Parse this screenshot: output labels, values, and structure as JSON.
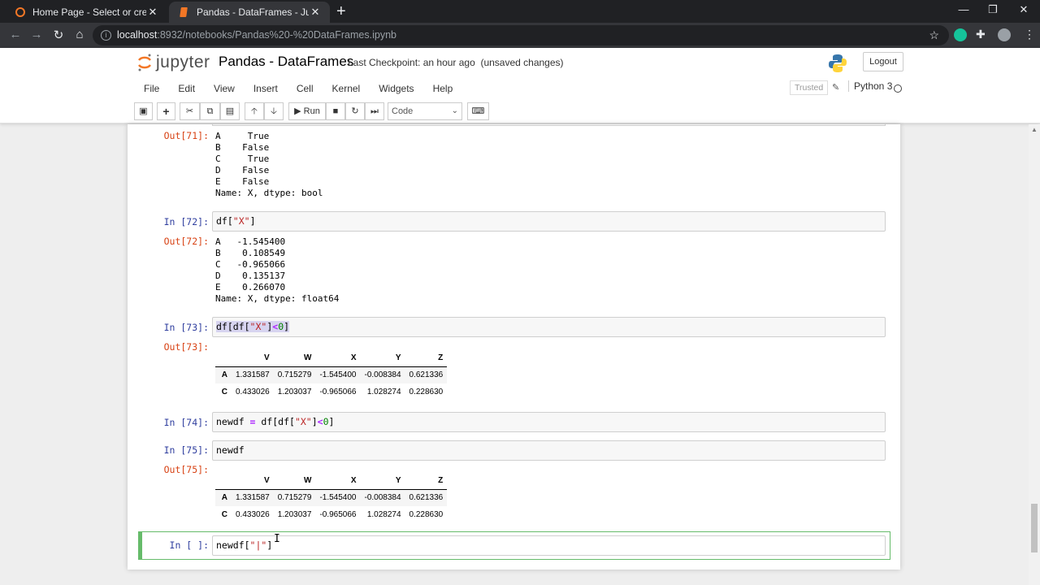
{
  "browser": {
    "tabs": [
      {
        "title": "Home Page - Select or create a n",
        "active": false
      },
      {
        "title": "Pandas - DataFrames - Jupyter N",
        "active": true
      }
    ],
    "url_host": "localhost",
    "url_path": ":8932/notebooks/Pandas%20-%20DataFrames.ipynb"
  },
  "jupyter": {
    "logo_text": "jupyter",
    "notebook_title": "Pandas - DataFrames",
    "checkpoint": "Last Checkpoint: an hour ago",
    "unsaved": "(unsaved changes)",
    "logout": "Logout",
    "menu": [
      "File",
      "Edit",
      "View",
      "Insert",
      "Cell",
      "Kernel",
      "Widgets",
      "Help"
    ],
    "trusted": "Trusted",
    "kernel_name": "Python 3",
    "toolbar": {
      "run_label": "Run",
      "cell_type": "Code"
    }
  },
  "cells": {
    "out71": {
      "prompt": "Out[71]:",
      "text": "A     True\nB    False\nC     True\nD    False\nE    False\nName: X, dtype: bool"
    },
    "in72": {
      "prompt": "In [72]:"
    },
    "out72": {
      "prompt": "Out[72]:",
      "text": "A   -1.545400\nB    0.108549\nC   -0.965066\nD    0.135137\nE    0.266070\nName: X, dtype: float64"
    },
    "in73": {
      "prompt": "In [73]:"
    },
    "out73": {
      "prompt": "Out[73]:"
    },
    "in74": {
      "prompt": "In [74]:"
    },
    "in75": {
      "prompt": "In [75]:",
      "code": "newdf"
    },
    "out75": {
      "prompt": "Out[75]:"
    },
    "in_new": {
      "prompt": "In [ ]:"
    }
  },
  "dataframe": {
    "columns": [
      "V",
      "W",
      "X",
      "Y",
      "Z"
    ],
    "rows": [
      {
        "index": "A",
        "values": [
          "1.331587",
          "0.715279",
          "-1.545400",
          "-0.008384",
          "0.621336"
        ]
      },
      {
        "index": "C",
        "values": [
          "0.433026",
          "1.203037",
          "-0.965066",
          "1.028274",
          "0.228630"
        ]
      }
    ]
  }
}
